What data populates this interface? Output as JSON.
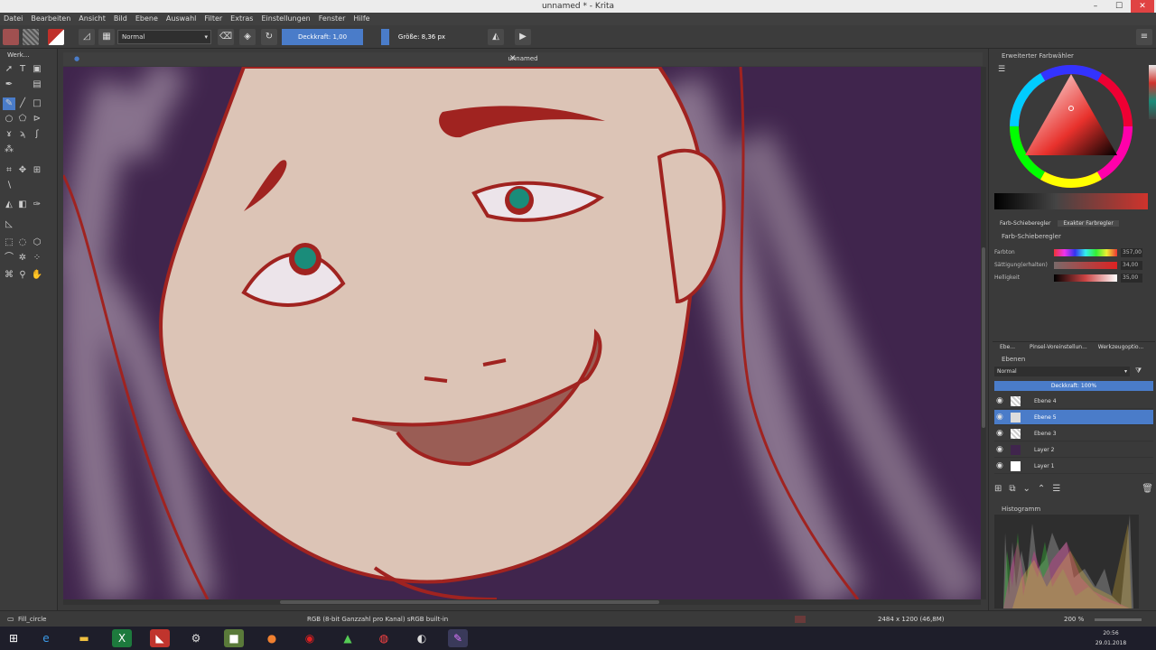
{
  "window": {
    "title": "unnamed * - Krita",
    "minimize": "–",
    "maximize": "☐",
    "close": "✕"
  },
  "menu": [
    "Datei",
    "Bearbeiten",
    "Ansicht",
    "Bild",
    "Ebene",
    "Auswahl",
    "Filter",
    "Extras",
    "Einstellungen",
    "Fenster",
    "Hilfe"
  ],
  "toolbar": {
    "blend_mode": "Normal",
    "opacity_label": "Deckkraft:  1,00",
    "size_label": "Größe:  8,36 px"
  },
  "toolbox": {
    "title": "Werk..."
  },
  "document": {
    "tab_name": "unnamed"
  },
  "color_selector": {
    "title": "Erweiterter Farbwähler",
    "tab1": "Farb-Schieberegler",
    "tab2": "Exakter Farbregler",
    "sub_title": "Farb-Schieberegler",
    "rows": [
      {
        "label": "Farbton",
        "value": "357,00"
      },
      {
        "label": "Sättigung(erhalten)",
        "value": "34,00"
      },
      {
        "label": "Helligkeit",
        "value": "35,00"
      }
    ]
  },
  "panel_tabs": [
    "Ebe...",
    "Pinsel-Voreinstellun...",
    "Werkzeugoptio..."
  ],
  "layers": {
    "title": "Ebenen",
    "blend": "Normal",
    "opacity": "Deckkraft:  100%",
    "items": [
      {
        "name": "Ebene 4"
      },
      {
        "name": "Ebene 5"
      },
      {
        "name": "Ebene 3"
      },
      {
        "name": "Layer 2"
      },
      {
        "name": "Layer 1"
      }
    ]
  },
  "histogram": {
    "title": "Histogramm"
  },
  "status": {
    "brush": "Fill_circle",
    "colorspace": "RGB (8-bit Ganzzahl pro Kanal)  sRGB built-in",
    "dimensions": "2484 x 1200 (46,8M)",
    "zoom": "200 %"
  },
  "taskbar": {
    "time": "20:56",
    "date": "29.01.2018"
  },
  "colors": {
    "accent": "#4a7cc9",
    "canvas_bg": "#40254d",
    "line": "#a02320",
    "skin": "#dcc4b6"
  }
}
